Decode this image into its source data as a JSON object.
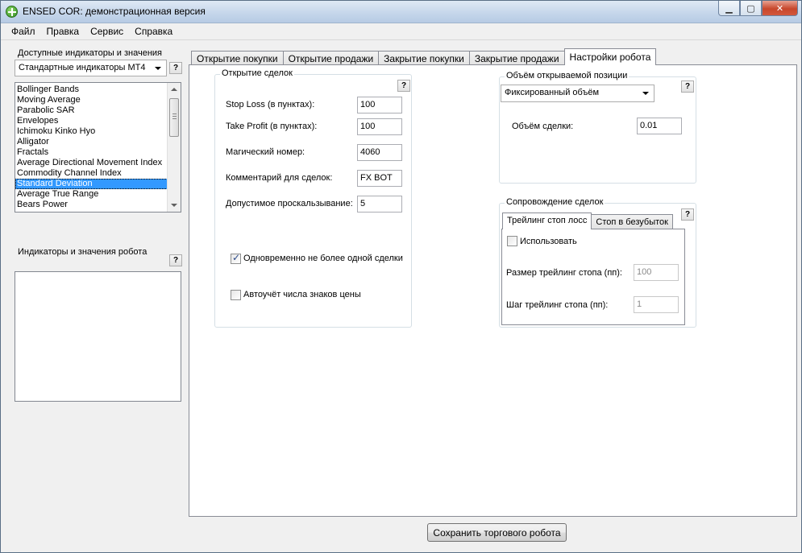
{
  "window": {
    "title": "ENSED COR: демонстрационная версия"
  },
  "menu": [
    "Файл",
    "Правка",
    "Сервис",
    "Справка"
  ],
  "left_panel": {
    "available_label": "Доступные индикаторы и значения",
    "indicator_set": "Стандартные индикаторы МТ4",
    "help": "?",
    "indicators": [
      "Bollinger Bands",
      "Moving Average",
      "Parabolic SAR",
      "Envelopes",
      "Ichimoku Kinko Hyo",
      "Alligator",
      "Fractals",
      "Average Directional Movement Index",
      "Commodity Channel Index",
      "Standard Deviation",
      "Average True Range",
      "Bears Power"
    ],
    "selected_index": 9,
    "robot_label": "Индикаторы и значения робота"
  },
  "tabs": [
    "Открытие покупки",
    "Открытие продажи",
    "Закрытие покупки",
    "Закрытие продажи",
    "Настройки робота"
  ],
  "active_tab": 4,
  "opening": {
    "legend": "Открытие сделок",
    "stop_loss_label": "Stop Loss (в пунктах):",
    "stop_loss": "100",
    "take_profit_label": "Take Profit (в пунктах):",
    "take_profit": "100",
    "magic_label": "Магический номер:",
    "magic": "4060",
    "comment_label": "Комментарий для сделок:",
    "comment": "FX BOT",
    "slippage_label": "Допустимое проскальзывание:",
    "slippage": "5",
    "one_trade_label": "Одновременно не более одной сделки",
    "one_trade_checked": true,
    "auto_digits_label": "Автоучёт числа знаков цены",
    "auto_digits_checked": false
  },
  "volume": {
    "legend": "Объём открываемой позиции",
    "mode": "Фиксированный объём",
    "lot_label": "Объём сделки:",
    "lot": "0.01"
  },
  "tracking": {
    "legend": "Сопровождение сделок",
    "tabs": [
      "Трейлинг стоп лосс",
      "Стоп в безубыток"
    ],
    "active_tab": 0,
    "use_label": "Использовать",
    "use_checked": false,
    "size_label": "Размер трейлинг стопа (пп):",
    "size": "100",
    "step_label": "Шаг трейлинг стопа (пп):",
    "step": "1"
  },
  "save_button": "Сохранить торгового робота"
}
